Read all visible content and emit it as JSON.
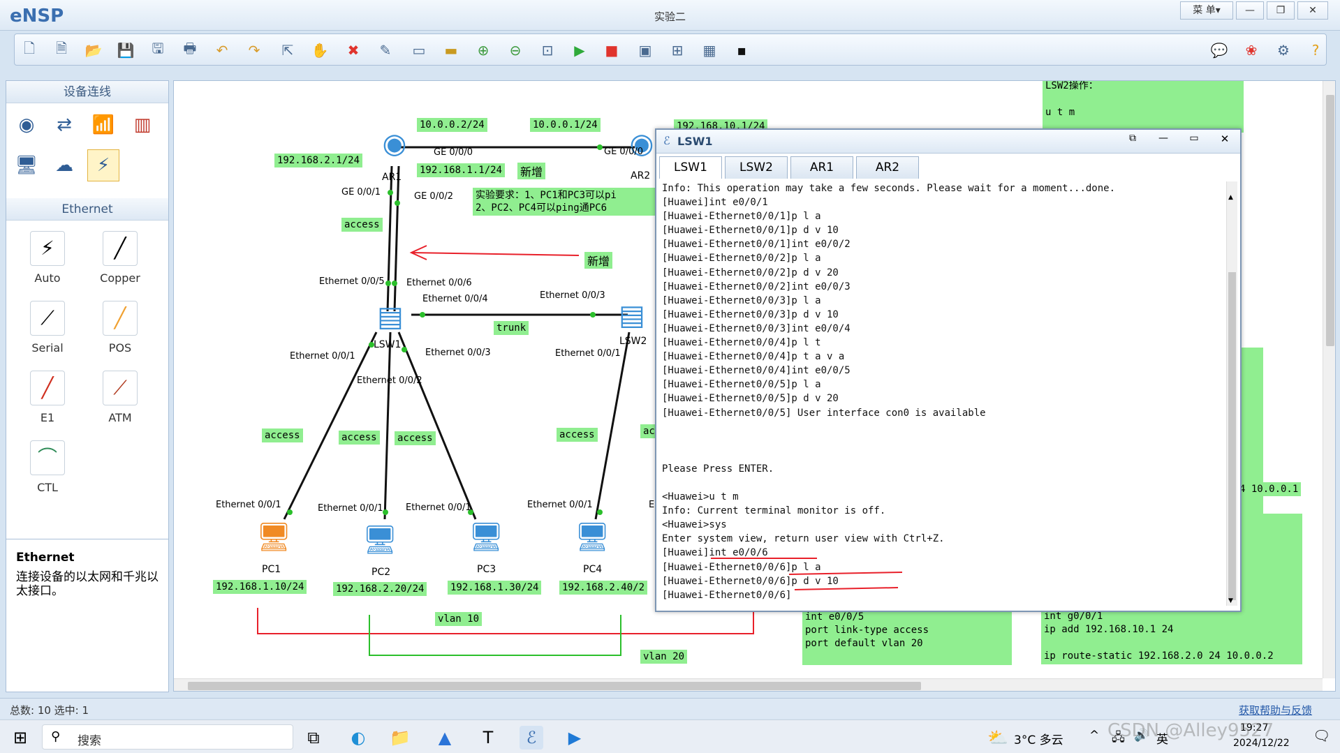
{
  "app": {
    "name": "eNSP",
    "window_title": "实验二",
    "menu_label": "菜 单▾"
  },
  "left_panel": {
    "section1_title": "设备连线",
    "section2_title": "Ethernet",
    "cables": [
      {
        "label": "Auto",
        "icon": "auto-cable-icon"
      },
      {
        "label": "Copper",
        "icon": "copper-cable-icon"
      },
      {
        "label": "Serial",
        "icon": "serial-cable-icon"
      },
      {
        "label": "POS",
        "icon": "pos-cable-icon"
      },
      {
        "label": "E1",
        "icon": "e1-cable-icon"
      },
      {
        "label": "ATM",
        "icon": "atm-cable-icon"
      },
      {
        "label": "CTL",
        "icon": "ctl-cable-icon"
      }
    ],
    "info_title": "Ethernet",
    "info_desc": "连接设备的以太网和千兆以太接口。"
  },
  "topology": {
    "green_labels": {
      "ar1_ge000_ip": "10.0.0.2/24",
      "ar2_ge000_ip": "10.0.0.1/24",
      "ar2_lan_ip": "192.168.10.1/24",
      "ar1_gw2": "192.168.2.1/24",
      "ar1_gw1": "192.168.1.1/24",
      "new_tag1": "新增",
      "access_top": "access",
      "new_tag2": "新增",
      "trunk": "trunk",
      "access_pc1": "access",
      "access_pc2": "access",
      "access_pc3": "access",
      "access_pc4": "access",
      "access_cut": "ac",
      "pc1_ip": "192.168.1.10/24",
      "pc2_ip": "192.168.2.20/24",
      "pc3_ip": "192.168.1.30/24",
      "pc4_ip": "192.168.2.40/2",
      "vlan10": "vlan 10",
      "vlan20": "vlan 20",
      "right_ip": "4 10.0.0.1"
    },
    "requirement_line1": "实验要求：1、PC1和PC3可以pi",
    "requirement_line2": "2、PC2、PC4可以ping通PC6",
    "port_labels": {
      "ar1_ge000": "GE 0/0/0",
      "ar2_ge000": "GE 0/0/0",
      "ar1_ge001": "GE 0/0/1",
      "ar1_ge002": "GE 0/0/2",
      "lsw1_e005": "Ethernet 0/0/5",
      "lsw1_e006": "Ethernet 0/0/6",
      "lsw1_e004": "Ethernet 0/0/4",
      "lsw2_e003": "Ethernet 0/0/3",
      "lsw1_e001": "Ethernet 0/0/1",
      "lsw1_e003": "Ethernet 0/0/3",
      "lsw2_e001": "Ethernet 0/0/1",
      "lsw1_e002": "Ethernet 0/0/2",
      "pc1_e001": "Ethernet 0/0/1",
      "pc2_e001": "Ethernet 0/0/1",
      "pc3_e001": "Ethernet 0/0/1",
      "pc4_e001": "Ethernet 0/0/1",
      "pc5_e_cut": "E"
    },
    "devices": {
      "ar1": "AR1",
      "ar2": "AR2",
      "lsw1": "LSW1",
      "lsw2": "LSW2",
      "pc1": "PC1",
      "pc2": "PC2",
      "pc3": "PC3",
      "pc4": "PC4"
    },
    "notes": {
      "lsw2_ops": "LSW2操作：\n\nu t m",
      "lsw_cmds": "int e0/0/5\nport link-type access\nport default vlan 20",
      "ar_cmds": "int g0/0/1\nip add 192.168.10.1 24\n\nip route-static 192.168.2.0 24 10.0.0.2"
    }
  },
  "terminal": {
    "title": "LSW1",
    "tabs": [
      "LSW1",
      "LSW2",
      "AR1",
      "AR2"
    ],
    "active_tab": "LSW1",
    "lines": [
      "Info: This operation may take a few seconds. Please wait for a moment...done.",
      "[Huawei]int e0/0/1",
      "[Huawei-Ethernet0/0/1]p l a",
      "[Huawei-Ethernet0/0/1]p d v 10",
      "[Huawei-Ethernet0/0/1]int e0/0/2",
      "[Huawei-Ethernet0/0/2]p l a",
      "[Huawei-Ethernet0/0/2]p d v 20",
      "[Huawei-Ethernet0/0/2]int e0/0/3",
      "[Huawei-Ethernet0/0/3]p l a",
      "[Huawei-Ethernet0/0/3]p d v 10",
      "[Huawei-Ethernet0/0/3]int e0/0/4",
      "[Huawei-Ethernet0/0/4]p l t",
      "[Huawei-Ethernet0/0/4]p t a v a",
      "[Huawei-Ethernet0/0/4]int e0/0/5",
      "[Huawei-Ethernet0/0/5]p l a",
      "[Huawei-Ethernet0/0/5]p d v 20",
      "[Huawei-Ethernet0/0/5] User interface con0 is available",
      "",
      "",
      "",
      "Please Press ENTER.",
      "",
      "<Huawei>u t m",
      "Info: Current terminal monitor is off.",
      "<Huawei>sys",
      "Enter system view, return user view with Ctrl+Z.",
      "[Huawei]int e0/0/6",
      "[Huawei-Ethernet0/0/6]p l a",
      "[Huawei-Ethernet0/0/6]p d v 10",
      "[Huawei-Ethernet0/0/6]"
    ]
  },
  "statusbar": {
    "count": "总数: 10 选中: 1",
    "help_link": "获取帮助与反馈"
  },
  "taskbar": {
    "search": "搜索",
    "weather": "3°C 多云",
    "ime": "英",
    "time": "19:27",
    "date": "2024/12/22",
    "watermark": "CSDN @Alley9527"
  },
  "colors": {
    "label_green": "#90ee90",
    "annotation_red": "#e8202a",
    "accent_blue": "#3b6fb0"
  }
}
